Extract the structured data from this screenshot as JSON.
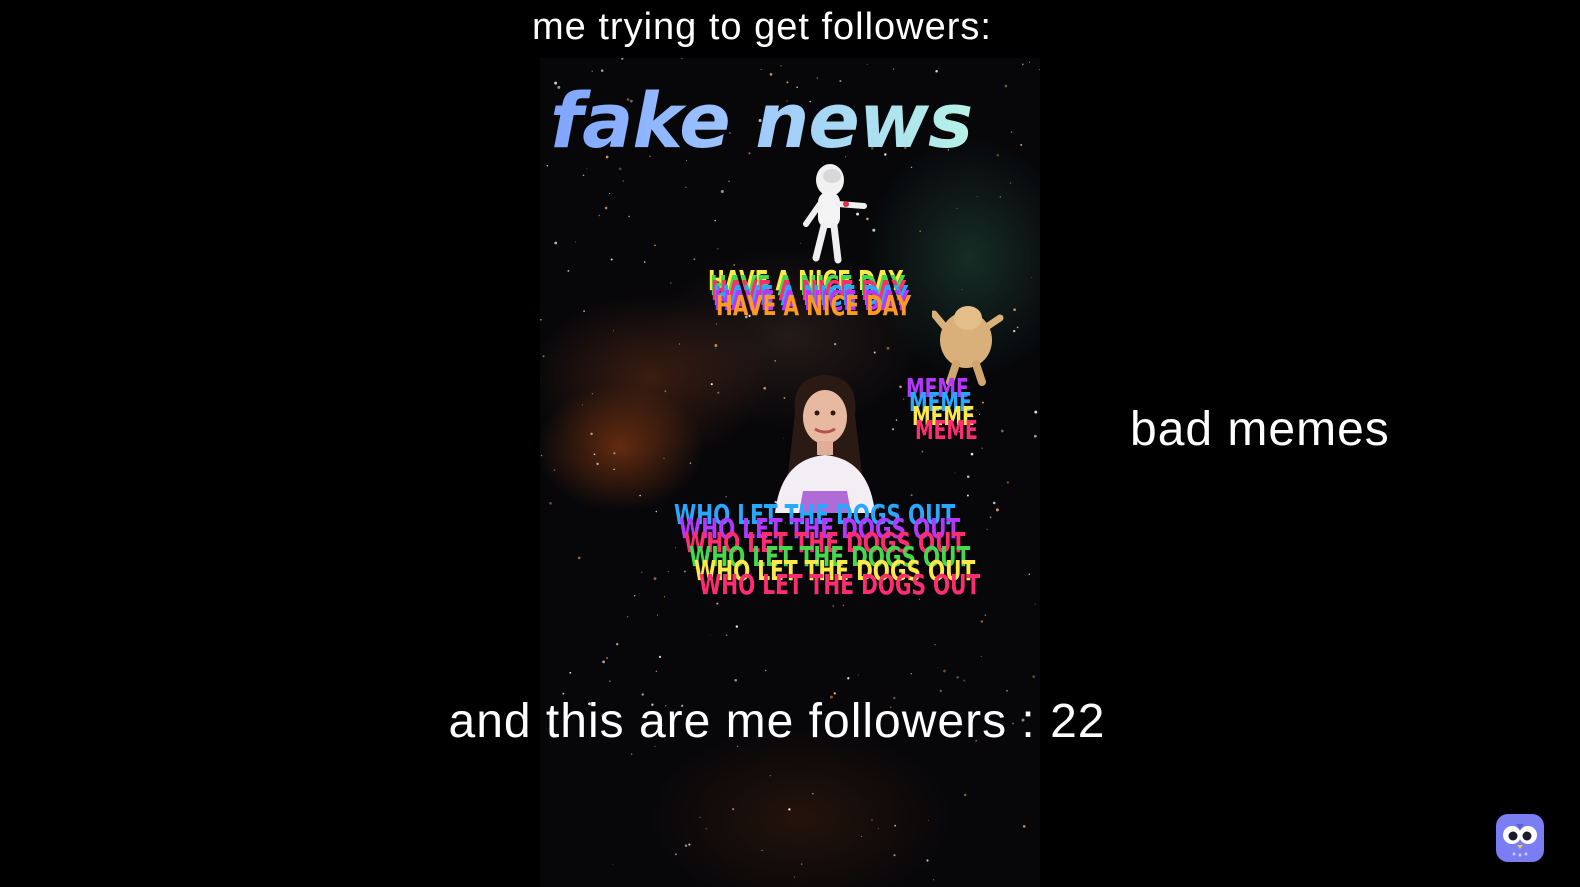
{
  "captions": {
    "top": "me trying to get followers:",
    "right": "bad memes",
    "bottom": "and this are me followers : 22"
  },
  "video": {
    "headline": "fake news",
    "phrases": {
      "nice_day": "HAVE A NICE DAY",
      "meme": "MEME",
      "dogs": "WHO LET THE DOGS OUT"
    },
    "figures": [
      "dancing-creature",
      "dancing-blob",
      "smiling-girl"
    ]
  },
  "colors": {
    "background": "#000000",
    "caption": "#ffffff",
    "rainbow": [
      "#ff2d6f",
      "#ff9a1f",
      "#ffe84a",
      "#42d94c",
      "#2aa8ff",
      "#b437ff"
    ]
  },
  "app_icon": "owl-icon"
}
